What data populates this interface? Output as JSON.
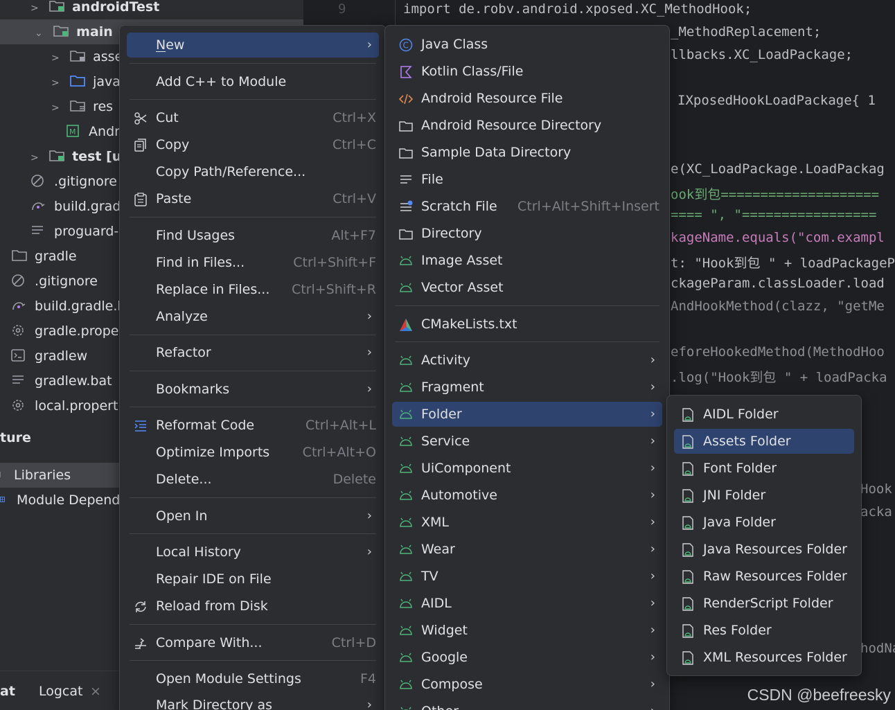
{
  "tree": {
    "items": [
      {
        "label": "androidTest",
        "bold": true
      },
      {
        "label": "main",
        "bold": true
      },
      {
        "label": "asset"
      },
      {
        "label": "java"
      },
      {
        "label": "res"
      },
      {
        "label": "Andr"
      },
      {
        "label": "test [uni"
      },
      {
        "label": ".gitignore"
      },
      {
        "label": "build.gradl"
      },
      {
        "label": "proguard-r"
      },
      {
        "label": "gradle"
      },
      {
        "label": ".gitignore"
      },
      {
        "label": "build.gradle.kt"
      },
      {
        "label": "gradle.propert"
      },
      {
        "label": "gradlew"
      },
      {
        "label": "gradlew.bat"
      },
      {
        "label": "local.propertie"
      }
    ],
    "section_title": "ture",
    "libraries": "Libraries",
    "module_deps": "Module Depender",
    "tabs": {
      "left": "at",
      "logcat": "Logcat",
      "close": "×"
    }
  },
  "editor": {
    "line_number": "9",
    "lines": [
      "import de.robv.android.xposed.XC_MethodHook;",
      "_MethodReplacement;",
      "llbacks.XC_LoadPackage;",
      "IXposedHookLoadPackage{  1",
      "e(XC_LoadPackage.LoadPackag",
      "ook到包====================",
      "==== \", \"=================",
      "kageName.equals(\"com.exampl",
      "t: \"Hook到包 \" + loadPackageP",
      "ckageParam.classLoader.load",
      "AndHookMethod(clazz, \"getMe",
      "eforeHookedMethod(MethodHoo",
      ".log(\"Hook到包 \" + loadPacka",
      "Hook",
      "acka",
      "hodNa"
    ],
    "watermark": "CSDN @beefreesky"
  },
  "context_menu": {
    "items": [
      {
        "label": "New",
        "u": "N",
        "rest": "ew",
        "highlight": true,
        "submenu": true
      },
      {
        "label": "Add C++ to Module"
      },
      {
        "label": "Cut",
        "shortcut": "Ctrl+X",
        "icon": "scissors-icon"
      },
      {
        "label": "Copy",
        "shortcut": "Ctrl+C",
        "icon": "copy-icon"
      },
      {
        "label": "Copy Path/Reference..."
      },
      {
        "label": "Paste",
        "shortcut": "Ctrl+V",
        "icon": "paste-icon"
      },
      {
        "label": "Find Usages",
        "shortcut": "Alt+F7"
      },
      {
        "label": "Find in Files...",
        "shortcut": "Ctrl+Shift+F"
      },
      {
        "label": "Replace in Files...",
        "shortcut": "Ctrl+Shift+R"
      },
      {
        "label": "Analyze",
        "submenu": true
      },
      {
        "label": "Refactor",
        "submenu": true
      },
      {
        "label": "Bookmarks",
        "submenu": true
      },
      {
        "label": "Reformat Code",
        "shortcut": "Ctrl+Alt+L",
        "icon": "reformat-icon"
      },
      {
        "label": "Optimize Imports",
        "shortcut": "Ctrl+Alt+O"
      },
      {
        "label": "Delete...",
        "shortcut": "Delete"
      },
      {
        "label": "Open In",
        "submenu": true
      },
      {
        "label": "Local History",
        "submenu": true
      },
      {
        "label": "Repair IDE on File"
      },
      {
        "label": "Reload from Disk",
        "icon": "reload-icon"
      },
      {
        "label": "Compare With...",
        "shortcut": "Ctrl+D",
        "icon": "compare-icon"
      },
      {
        "label": "Open Module Settings",
        "shortcut": "F4"
      },
      {
        "label": "Mark Directory as",
        "submenu": true
      }
    ]
  },
  "new_menu": {
    "items": [
      {
        "label": "Java Class",
        "icon": "java-class-icon"
      },
      {
        "label": "Kotlin Class/File",
        "icon": "kotlin-icon"
      },
      {
        "label": "Android Resource File",
        "icon": "xml-code-icon"
      },
      {
        "label": "Android Resource Directory",
        "icon": "folder-icon"
      },
      {
        "label": "Sample Data Directory",
        "icon": "folder-icon"
      },
      {
        "label": "File",
        "icon": "file-lines-icon"
      },
      {
        "label": "Scratch File",
        "shortcut": "Ctrl+Alt+Shift+Insert",
        "icon": "scratch-file-icon"
      },
      {
        "label": "Directory",
        "icon": "folder-icon"
      },
      {
        "label": "Image Asset",
        "icon": "android-icon"
      },
      {
        "label": "Vector Asset",
        "icon": "android-icon"
      },
      {
        "label": "CMakeLists.txt",
        "icon": "cmake-icon"
      },
      {
        "label": "Activity",
        "icon": "android-icon",
        "submenu": true
      },
      {
        "label": "Fragment",
        "icon": "android-icon",
        "submenu": true
      },
      {
        "label": "Folder",
        "icon": "android-icon",
        "submenu": true,
        "highlight": true
      },
      {
        "label": "Service",
        "icon": "android-icon",
        "submenu": true
      },
      {
        "label": "UiComponent",
        "icon": "android-icon",
        "submenu": true
      },
      {
        "label": "Automotive",
        "icon": "android-icon",
        "submenu": true
      },
      {
        "label": "XML",
        "icon": "android-icon",
        "submenu": true
      },
      {
        "label": "Wear",
        "icon": "android-icon",
        "submenu": true
      },
      {
        "label": "TV",
        "icon": "android-icon",
        "submenu": true
      },
      {
        "label": "AIDL",
        "icon": "android-icon",
        "submenu": true
      },
      {
        "label": "Widget",
        "icon": "android-icon",
        "submenu": true
      },
      {
        "label": "Google",
        "icon": "android-icon",
        "submenu": true
      },
      {
        "label": "Compose",
        "icon": "android-icon",
        "submenu": true
      },
      {
        "label": "Other",
        "icon": "android-icon",
        "submenu": true
      }
    ]
  },
  "folder_menu": {
    "items": [
      {
        "label": "AIDL Folder"
      },
      {
        "label": "Assets Folder",
        "highlight": true
      },
      {
        "label": "Font Folder"
      },
      {
        "label": "JNI Folder"
      },
      {
        "label": "Java Folder"
      },
      {
        "label": "Java Resources Folder"
      },
      {
        "label": "Raw Resources Folder"
      },
      {
        "label": "RenderScript Folder"
      },
      {
        "label": "Res Folder"
      },
      {
        "label": "XML Resources Folder"
      }
    ]
  },
  "colors": {
    "highlight": "#2e436e",
    "android_green": "#4fb57a",
    "java_blue": "#548af7",
    "kotlin_purple": "#b07ff0"
  }
}
